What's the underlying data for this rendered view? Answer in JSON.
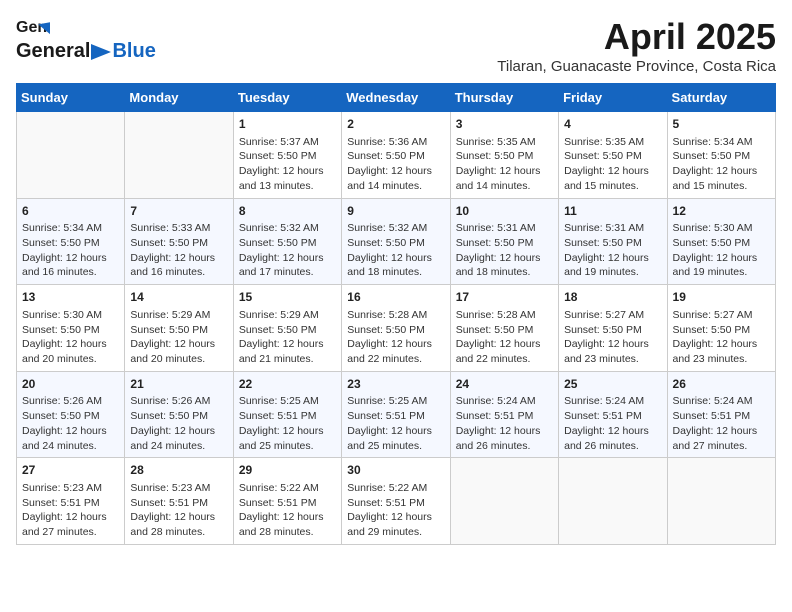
{
  "header": {
    "logo_general": "General",
    "logo_blue": "Blue",
    "month": "April 2025",
    "location": "Tilaran, Guanacaste Province, Costa Rica"
  },
  "columns": [
    "Sunday",
    "Monday",
    "Tuesday",
    "Wednesday",
    "Thursday",
    "Friday",
    "Saturday"
  ],
  "weeks": [
    [
      {
        "day": "",
        "info": ""
      },
      {
        "day": "",
        "info": ""
      },
      {
        "day": "1",
        "info": "Sunrise: 5:37 AM\nSunset: 5:50 PM\nDaylight: 12 hours and 13 minutes."
      },
      {
        "day": "2",
        "info": "Sunrise: 5:36 AM\nSunset: 5:50 PM\nDaylight: 12 hours and 14 minutes."
      },
      {
        "day": "3",
        "info": "Sunrise: 5:35 AM\nSunset: 5:50 PM\nDaylight: 12 hours and 14 minutes."
      },
      {
        "day": "4",
        "info": "Sunrise: 5:35 AM\nSunset: 5:50 PM\nDaylight: 12 hours and 15 minutes."
      },
      {
        "day": "5",
        "info": "Sunrise: 5:34 AM\nSunset: 5:50 PM\nDaylight: 12 hours and 15 minutes."
      }
    ],
    [
      {
        "day": "6",
        "info": "Sunrise: 5:34 AM\nSunset: 5:50 PM\nDaylight: 12 hours and 16 minutes."
      },
      {
        "day": "7",
        "info": "Sunrise: 5:33 AM\nSunset: 5:50 PM\nDaylight: 12 hours and 16 minutes."
      },
      {
        "day": "8",
        "info": "Sunrise: 5:32 AM\nSunset: 5:50 PM\nDaylight: 12 hours and 17 minutes."
      },
      {
        "day": "9",
        "info": "Sunrise: 5:32 AM\nSunset: 5:50 PM\nDaylight: 12 hours and 18 minutes."
      },
      {
        "day": "10",
        "info": "Sunrise: 5:31 AM\nSunset: 5:50 PM\nDaylight: 12 hours and 18 minutes."
      },
      {
        "day": "11",
        "info": "Sunrise: 5:31 AM\nSunset: 5:50 PM\nDaylight: 12 hours and 19 minutes."
      },
      {
        "day": "12",
        "info": "Sunrise: 5:30 AM\nSunset: 5:50 PM\nDaylight: 12 hours and 19 minutes."
      }
    ],
    [
      {
        "day": "13",
        "info": "Sunrise: 5:30 AM\nSunset: 5:50 PM\nDaylight: 12 hours and 20 minutes."
      },
      {
        "day": "14",
        "info": "Sunrise: 5:29 AM\nSunset: 5:50 PM\nDaylight: 12 hours and 20 minutes."
      },
      {
        "day": "15",
        "info": "Sunrise: 5:29 AM\nSunset: 5:50 PM\nDaylight: 12 hours and 21 minutes."
      },
      {
        "day": "16",
        "info": "Sunrise: 5:28 AM\nSunset: 5:50 PM\nDaylight: 12 hours and 22 minutes."
      },
      {
        "day": "17",
        "info": "Sunrise: 5:28 AM\nSunset: 5:50 PM\nDaylight: 12 hours and 22 minutes."
      },
      {
        "day": "18",
        "info": "Sunrise: 5:27 AM\nSunset: 5:50 PM\nDaylight: 12 hours and 23 minutes."
      },
      {
        "day": "19",
        "info": "Sunrise: 5:27 AM\nSunset: 5:50 PM\nDaylight: 12 hours and 23 minutes."
      }
    ],
    [
      {
        "day": "20",
        "info": "Sunrise: 5:26 AM\nSunset: 5:50 PM\nDaylight: 12 hours and 24 minutes."
      },
      {
        "day": "21",
        "info": "Sunrise: 5:26 AM\nSunset: 5:50 PM\nDaylight: 12 hours and 24 minutes."
      },
      {
        "day": "22",
        "info": "Sunrise: 5:25 AM\nSunset: 5:51 PM\nDaylight: 12 hours and 25 minutes."
      },
      {
        "day": "23",
        "info": "Sunrise: 5:25 AM\nSunset: 5:51 PM\nDaylight: 12 hours and 25 minutes."
      },
      {
        "day": "24",
        "info": "Sunrise: 5:24 AM\nSunset: 5:51 PM\nDaylight: 12 hours and 26 minutes."
      },
      {
        "day": "25",
        "info": "Sunrise: 5:24 AM\nSunset: 5:51 PM\nDaylight: 12 hours and 26 minutes."
      },
      {
        "day": "26",
        "info": "Sunrise: 5:24 AM\nSunset: 5:51 PM\nDaylight: 12 hours and 27 minutes."
      }
    ],
    [
      {
        "day": "27",
        "info": "Sunrise: 5:23 AM\nSunset: 5:51 PM\nDaylight: 12 hours and 27 minutes."
      },
      {
        "day": "28",
        "info": "Sunrise: 5:23 AM\nSunset: 5:51 PM\nDaylight: 12 hours and 28 minutes."
      },
      {
        "day": "29",
        "info": "Sunrise: 5:22 AM\nSunset: 5:51 PM\nDaylight: 12 hours and 28 minutes."
      },
      {
        "day": "30",
        "info": "Sunrise: 5:22 AM\nSunset: 5:51 PM\nDaylight: 12 hours and 29 minutes."
      },
      {
        "day": "",
        "info": ""
      },
      {
        "day": "",
        "info": ""
      },
      {
        "day": "",
        "info": ""
      }
    ]
  ]
}
